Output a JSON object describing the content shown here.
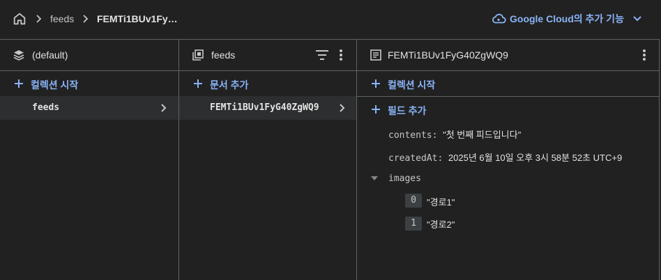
{
  "breadcrumb": {
    "home_icon": "home-icon",
    "items": [
      "feeds",
      "FEMTi1BUv1Fy…"
    ]
  },
  "google_cloud": {
    "label": "Google Cloud의 추가 기능",
    "icon": "cloud-icon",
    "accent": "#8ab4f8"
  },
  "col1": {
    "title": "(default)",
    "icon": "database-icon",
    "add_label": "컬렉션 시작",
    "items": [
      {
        "label": "feeds",
        "selected": true
      }
    ]
  },
  "col2": {
    "title": "feeds",
    "icon": "collection-icon",
    "add_label": "문서 추가",
    "items": [
      {
        "label": "FEMTi1BUv1FyG40ZgWQ9",
        "selected": true
      }
    ]
  },
  "col3": {
    "title": "FEMTi1BUv1FyG40ZgWQ9",
    "icon": "document-icon",
    "add_collection_label": "컬렉션 시작",
    "add_field_label": "필드 추가",
    "fields": [
      {
        "key": "contents:",
        "value": "\"첫 번째 피드입니다\""
      },
      {
        "key": "createdAt:",
        "value": "2025년 6월 10일 오후 3시 58분 52초 UTC+9"
      }
    ],
    "array_field": {
      "key": "images",
      "items": [
        {
          "index": "0",
          "value": "\"경로1\""
        },
        {
          "index": "1",
          "value": "\"경로2\""
        }
      ]
    }
  },
  "colors": {
    "background": "#212121",
    "selected_row": "#2d2e30",
    "divider": "#5f6368",
    "link": "#8ab4f8"
  }
}
